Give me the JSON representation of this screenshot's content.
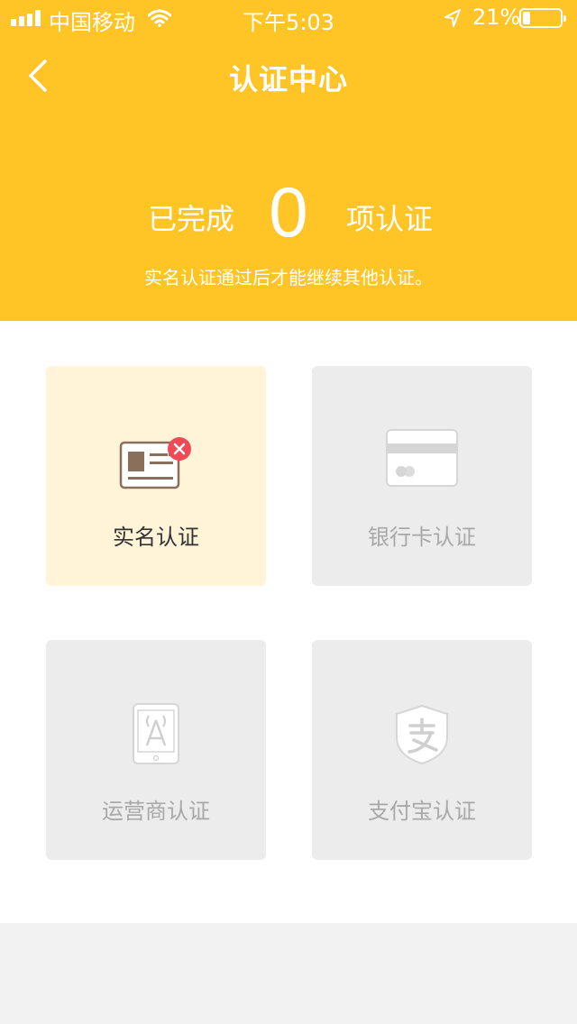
{
  "status_bar": {
    "carrier": "中国移动",
    "time": "下午5:03",
    "battery_percent": "21%",
    "battery_level": 0.21,
    "icons": [
      "signal-icon",
      "wifi-icon",
      "location-icon",
      "battery-icon"
    ]
  },
  "nav": {
    "title": "认证中心",
    "back_icon": "back-chevron-icon"
  },
  "summary": {
    "prefix": "已完成",
    "count": "0",
    "suffix": "项认证",
    "note": "实名认证通过后才能继续其他认证。"
  },
  "cards": [
    {
      "label": "实名认证",
      "icon": "id-card-icon",
      "status_icon": "error-x-icon",
      "active": true
    },
    {
      "label": "银行卡认证",
      "icon": "bank-card-icon",
      "active": false
    },
    {
      "label": "运营商认证",
      "icon": "phone-tower-icon",
      "active": false
    },
    {
      "label": "支付宝认证",
      "icon": "alipay-shield-icon",
      "active": false
    }
  ],
  "colors": {
    "header": "#ffc425",
    "active_card": "#fff3d8",
    "inactive_card": "#ececec",
    "error": "#ef4a55"
  }
}
